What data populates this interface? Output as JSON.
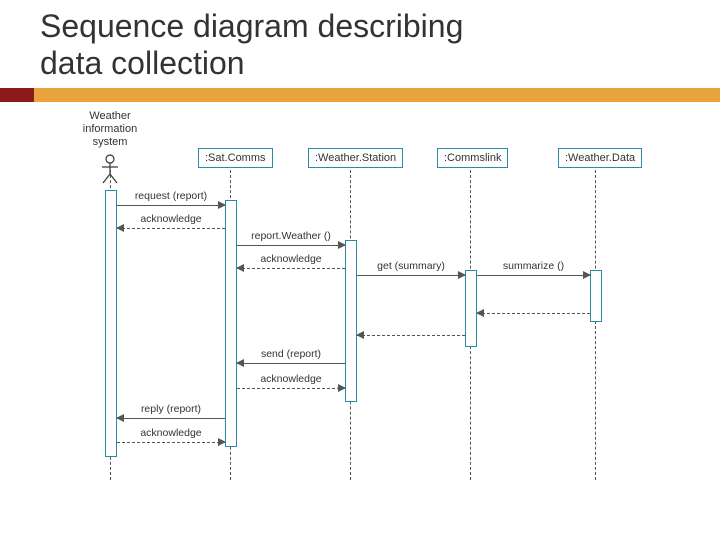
{
  "title_line1": "Sequence diagram describing",
  "title_line2": "data collection",
  "participants": {
    "actor": {
      "label_line1": "Weather",
      "label_line2": "information system"
    },
    "p1": {
      "label": ":Sat.Comms"
    },
    "p2": {
      "label": ":Weather.Station"
    },
    "p3": {
      "label": ":Commslink"
    },
    "p4": {
      "label": ":Weather.Data"
    }
  },
  "messages": {
    "m1": "request (report)",
    "m2": "acknowledge",
    "m3": "report.Weather ()",
    "m4": "acknowledge",
    "m5": "get (summary)",
    "m6": "summarize ()",
    "m7_return": "",
    "m8_return": "",
    "m9": "send (report)",
    "m10": "acknowledge",
    "m11": "reply (report)",
    "m12": "acknowledge"
  },
  "colors": {
    "accent": "#e8a33d",
    "accent_dark": "#8b1a1a",
    "box_border": "#2a8aa8"
  }
}
